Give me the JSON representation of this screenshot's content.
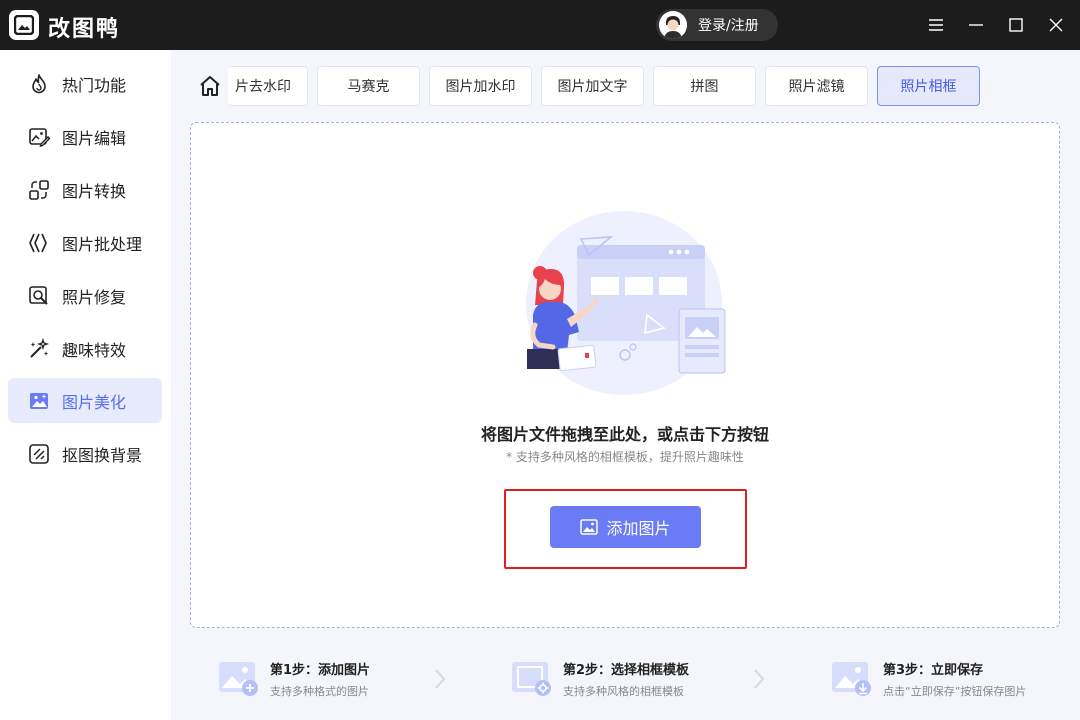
{
  "app": {
    "title": "改图鸭",
    "logo_icon": "photo-logo-icon"
  },
  "header": {
    "login_label": "登录/注册"
  },
  "sidebar": {
    "items": [
      {
        "label": "热门功能",
        "icon": "flame-icon"
      },
      {
        "label": "图片编辑",
        "icon": "image-edit-icon"
      },
      {
        "label": "图片转换",
        "icon": "convert-icon"
      },
      {
        "label": "图片批处理",
        "icon": "batch-icon"
      },
      {
        "label": "照片修复",
        "icon": "photo-repair-icon"
      },
      {
        "label": "趣味特效",
        "icon": "magic-wand-icon"
      },
      {
        "label": "图片美化",
        "icon": "image-beautify-icon",
        "active": true
      },
      {
        "label": "抠图换背景",
        "icon": "cutout-icon"
      }
    ]
  },
  "tabs": [
    {
      "label": "片去水印"
    },
    {
      "label": "马赛克"
    },
    {
      "label": "图片加水印"
    },
    {
      "label": "图片加文字"
    },
    {
      "label": "拼图"
    },
    {
      "label": "照片滤镜"
    },
    {
      "label": "照片相框",
      "active": true
    }
  ],
  "dropzone": {
    "title": "将图片文件拖拽至此处，或点击下方按钮",
    "subtitle": "* 支持多种风格的相框模板，提升照片趣味性",
    "button_label": "添加图片"
  },
  "steps": [
    {
      "title": "第1步：添加图片",
      "desc": "支持多种格式的图片"
    },
    {
      "title": "第2步：选择相框模板",
      "desc": "支持多种风格的相框模板"
    },
    {
      "title": "第3步：立即保存",
      "desc": "点击“立即保存”按钮保存图片"
    }
  ],
  "colors": {
    "accent": "#6b7bf5",
    "titlebar": "#1c1c1c",
    "highlight": "#e02020"
  }
}
